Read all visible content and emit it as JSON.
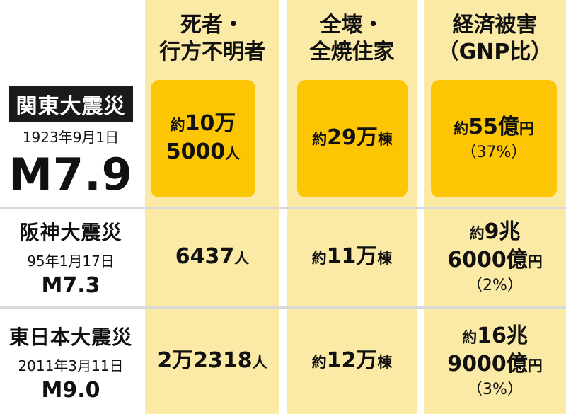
{
  "header": {
    "col1": [
      "死者・",
      "行方不明者"
    ],
    "col2": [
      "全壊・",
      "全焼住家"
    ],
    "col3": [
      "経済被害",
      "（GNP比）"
    ]
  },
  "rows": [
    {
      "name": "関東大震災",
      "date": "1923年9月1日",
      "magnitude": "M7.9",
      "deaths": {
        "line1_prefix": "約",
        "line1_num": "10万",
        "line2_num": "5000",
        "line2_unit": "人"
      },
      "houses": {
        "prefix": "約",
        "num": "29万",
        "unit": "棟"
      },
      "economic": {
        "prefix": "約",
        "num": "55億",
        "unit": "円",
        "ratio": "（37%）"
      }
    },
    {
      "name": "阪神大震災",
      "date": "95年1月17日",
      "magnitude": "M7.3",
      "deaths": {
        "num": "6437",
        "unit": "人"
      },
      "houses": {
        "prefix": "約",
        "num": "11万",
        "unit": "棟"
      },
      "economic": {
        "line1_prefix": "約",
        "line1_num": "9兆",
        "line2_num": "6000億",
        "line2_unit": "円",
        "ratio": "（2%）"
      }
    },
    {
      "name": "東日本大震災",
      "date": "2011年3月11日",
      "magnitude": "M9.0",
      "deaths": {
        "num": "2万2318",
        "unit": "人"
      },
      "houses": {
        "prefix": "約",
        "num": "12万",
        "unit": "棟"
      },
      "economic": {
        "line1_prefix": "約",
        "line1_num": "16兆",
        "line2_num": "9000億",
        "line2_unit": "円",
        "ratio": "（3%）"
      }
    }
  ],
  "colors": {
    "column_bg": "#fbe9a6",
    "highlight_box": "#fcc604",
    "badge_bg": "#1a1a1a",
    "separator": "#d9d9d9"
  }
}
